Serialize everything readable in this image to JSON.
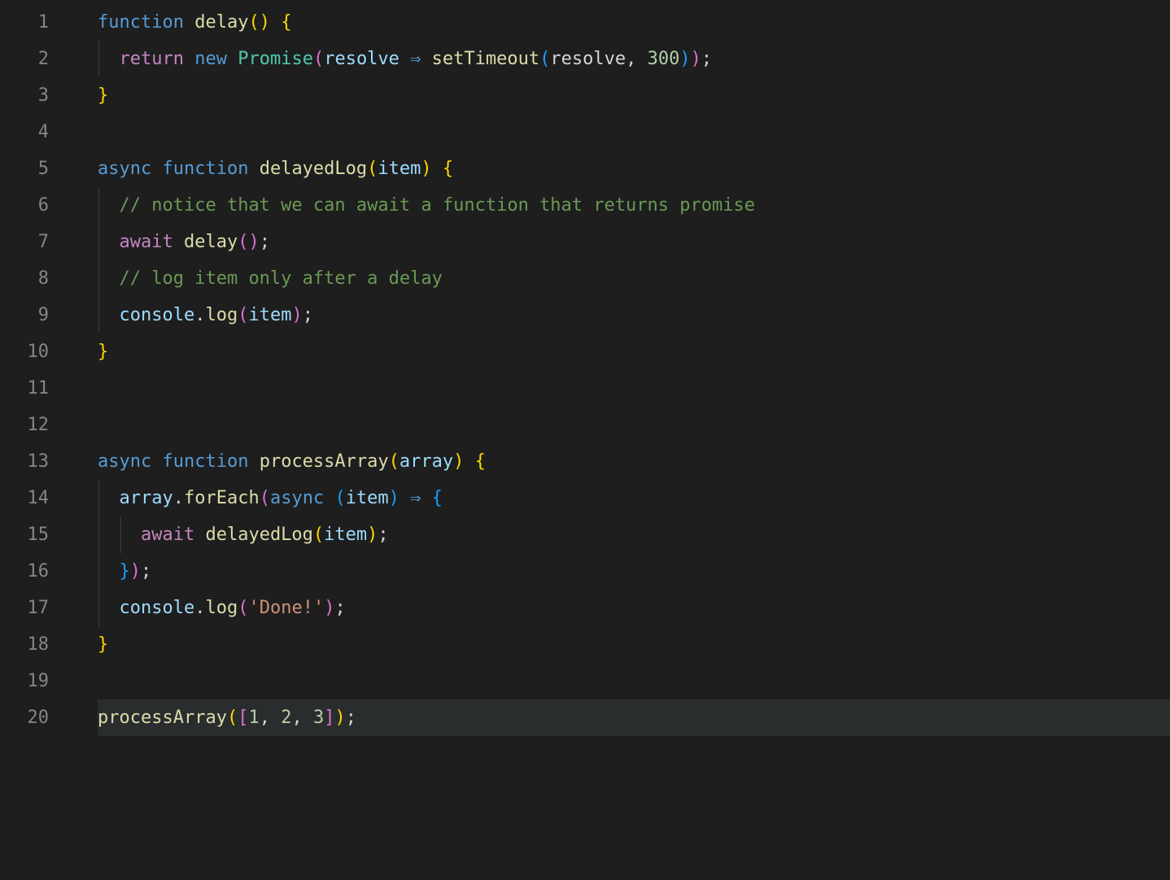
{
  "editor": {
    "line_count": 20,
    "active_line": 20,
    "lines": {
      "1": [
        {
          "t": "kw",
          "v": "function"
        },
        {
          "t": "sp",
          "v": " "
        },
        {
          "t": "fn",
          "v": "delay"
        },
        {
          "t": "p1",
          "v": "()"
        },
        {
          "t": "sp",
          "v": " "
        },
        {
          "t": "p1",
          "v": "{"
        }
      ],
      "2": [
        {
          "t": "ind",
          "v": "  "
        },
        {
          "t": "ctrl",
          "v": "return"
        },
        {
          "t": "sp",
          "v": " "
        },
        {
          "t": "kw",
          "v": "new"
        },
        {
          "t": "sp",
          "v": " "
        },
        {
          "t": "cls",
          "v": "Promise"
        },
        {
          "t": "p2",
          "v": "("
        },
        {
          "t": "par",
          "v": "resolve"
        },
        {
          "t": "sp",
          "v": " "
        },
        {
          "t": "arrow",
          "v": "⇒"
        },
        {
          "t": "sp",
          "v": " "
        },
        {
          "t": "fn",
          "v": "setTimeout"
        },
        {
          "t": "p3",
          "v": "("
        },
        {
          "t": "id",
          "v": "resolve"
        },
        {
          "t": "punct",
          "v": ","
        },
        {
          "t": "sp",
          "v": " "
        },
        {
          "t": "num",
          "v": "300"
        },
        {
          "t": "p3",
          "v": ")"
        },
        {
          "t": "p2",
          "v": ")"
        },
        {
          "t": "punct",
          "v": ";"
        }
      ],
      "3": [
        {
          "t": "p1",
          "v": "}"
        }
      ],
      "4": [],
      "5": [
        {
          "t": "kw",
          "v": "async"
        },
        {
          "t": "sp",
          "v": " "
        },
        {
          "t": "kw",
          "v": "function"
        },
        {
          "t": "sp",
          "v": " "
        },
        {
          "t": "fn",
          "v": "delayedLog"
        },
        {
          "t": "p1",
          "v": "("
        },
        {
          "t": "par",
          "v": "item"
        },
        {
          "t": "p1",
          "v": ")"
        },
        {
          "t": "sp",
          "v": " "
        },
        {
          "t": "p1",
          "v": "{"
        }
      ],
      "6": [
        {
          "t": "ind",
          "v": "  "
        },
        {
          "t": "com",
          "v": "// notice that we can await a function that returns promise"
        }
      ],
      "7": [
        {
          "t": "ind",
          "v": "  "
        },
        {
          "t": "ctrl",
          "v": "await"
        },
        {
          "t": "sp",
          "v": " "
        },
        {
          "t": "fn",
          "v": "delay"
        },
        {
          "t": "p2",
          "v": "()"
        },
        {
          "t": "punct",
          "v": ";"
        }
      ],
      "8": [
        {
          "t": "ind",
          "v": "  "
        },
        {
          "t": "com",
          "v": "// log item only after a delay"
        }
      ],
      "9": [
        {
          "t": "ind",
          "v": "  "
        },
        {
          "t": "obj",
          "v": "console"
        },
        {
          "t": "punct",
          "v": "."
        },
        {
          "t": "fn",
          "v": "log"
        },
        {
          "t": "p2",
          "v": "("
        },
        {
          "t": "par",
          "v": "item"
        },
        {
          "t": "p2",
          "v": ")"
        },
        {
          "t": "punct",
          "v": ";"
        }
      ],
      "10": [
        {
          "t": "p1",
          "v": "}"
        }
      ],
      "11": [],
      "12": [],
      "13": [
        {
          "t": "kw",
          "v": "async"
        },
        {
          "t": "sp",
          "v": " "
        },
        {
          "t": "kw",
          "v": "function"
        },
        {
          "t": "sp",
          "v": " "
        },
        {
          "t": "fn",
          "v": "processArray"
        },
        {
          "t": "p1",
          "v": "("
        },
        {
          "t": "par",
          "v": "array"
        },
        {
          "t": "p1",
          "v": ")"
        },
        {
          "t": "sp",
          "v": " "
        },
        {
          "t": "p1",
          "v": "{"
        }
      ],
      "14": [
        {
          "t": "ind",
          "v": "  "
        },
        {
          "t": "par",
          "v": "array"
        },
        {
          "t": "punct",
          "v": "."
        },
        {
          "t": "fn",
          "v": "forEach"
        },
        {
          "t": "p2",
          "v": "("
        },
        {
          "t": "kw",
          "v": "async"
        },
        {
          "t": "sp",
          "v": " "
        },
        {
          "t": "p3",
          "v": "("
        },
        {
          "t": "par",
          "v": "item"
        },
        {
          "t": "p3",
          "v": ")"
        },
        {
          "t": "sp",
          "v": " "
        },
        {
          "t": "arrow",
          "v": "⇒"
        },
        {
          "t": "sp",
          "v": " "
        },
        {
          "t": "p3",
          "v": "{"
        }
      ],
      "15": [
        {
          "t": "ind",
          "v": "    "
        },
        {
          "t": "ctrl",
          "v": "await"
        },
        {
          "t": "sp",
          "v": " "
        },
        {
          "t": "fn",
          "v": "delayedLog"
        },
        {
          "t": "p1",
          "v": "("
        },
        {
          "t": "par",
          "v": "item"
        },
        {
          "t": "p1",
          "v": ")"
        },
        {
          "t": "punct",
          "v": ";"
        }
      ],
      "16": [
        {
          "t": "ind",
          "v": "  "
        },
        {
          "t": "p3",
          "v": "}"
        },
        {
          "t": "p2",
          "v": ")"
        },
        {
          "t": "punct",
          "v": ";"
        }
      ],
      "17": [
        {
          "t": "ind",
          "v": "  "
        },
        {
          "t": "obj",
          "v": "console"
        },
        {
          "t": "punct",
          "v": "."
        },
        {
          "t": "fn",
          "v": "log"
        },
        {
          "t": "p2",
          "v": "("
        },
        {
          "t": "str",
          "v": "'Done!'"
        },
        {
          "t": "p2",
          "v": ")"
        },
        {
          "t": "punct",
          "v": ";"
        }
      ],
      "18": [
        {
          "t": "p1",
          "v": "}"
        }
      ],
      "19": [],
      "20": [
        {
          "t": "fn",
          "v": "processArray"
        },
        {
          "t": "p1",
          "v": "("
        },
        {
          "t": "p2",
          "v": "["
        },
        {
          "t": "num",
          "v": "1"
        },
        {
          "t": "punct",
          "v": ","
        },
        {
          "t": "sp",
          "v": " "
        },
        {
          "t": "num",
          "v": "2"
        },
        {
          "t": "punct",
          "v": ","
        },
        {
          "t": "sp",
          "v": " "
        },
        {
          "t": "num",
          "v": "3"
        },
        {
          "t": "p2",
          "v": "]"
        },
        {
          "t": "p1",
          "v": ")"
        },
        {
          "t": "punct",
          "v": ";"
        }
      ]
    },
    "indent_guides": {
      "2": [
        1
      ],
      "6": [
        1
      ],
      "7": [
        1
      ],
      "8": [
        1
      ],
      "9": [
        1
      ],
      "14": [
        1
      ],
      "15": [
        1,
        2
      ],
      "16": [
        1
      ],
      "17": [
        1
      ]
    }
  }
}
